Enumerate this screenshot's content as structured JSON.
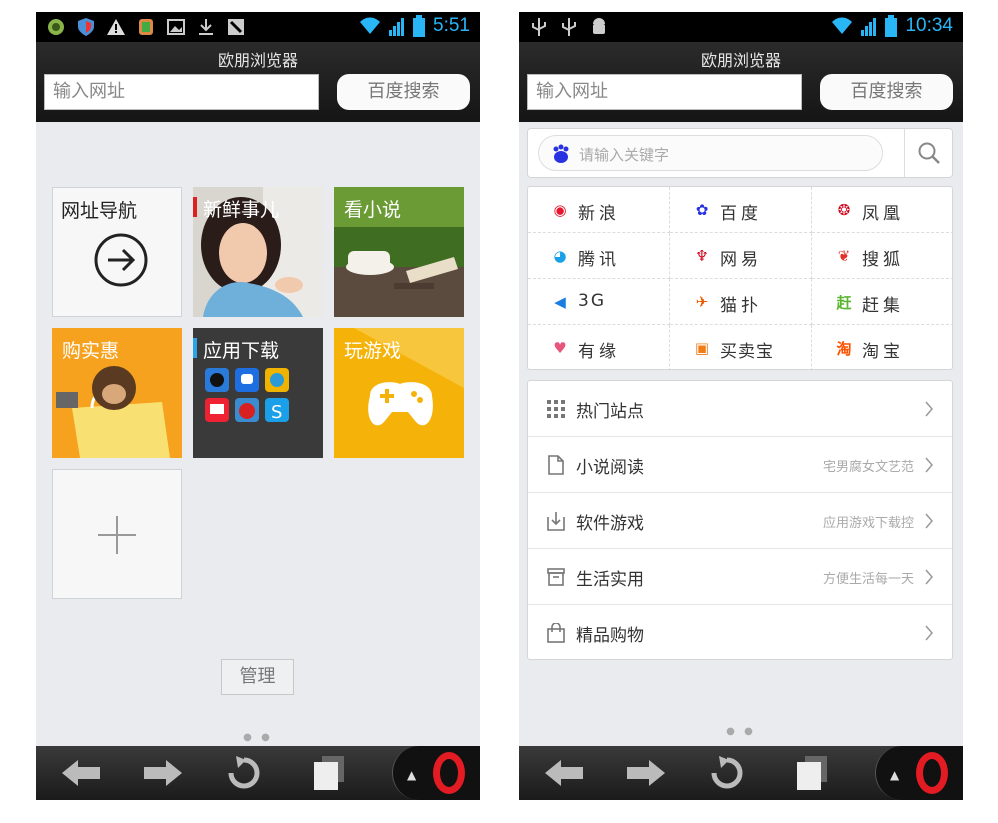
{
  "colors": {
    "status_time": "#29b6f6",
    "opera_red": "#e31b23",
    "tile_orange": "#f5a623",
    "tile_yellow": "#f6b600",
    "tile_dark": "#3a3a3a",
    "accent_red": "#e02020",
    "accent_blue": "#2aa3e8"
  },
  "left": {
    "status_time": "5:51",
    "app_title": "欧朋浏览器",
    "url_placeholder": "输入网址",
    "search_label": "百度搜索",
    "tiles": [
      {
        "label": "网址导航",
        "icon": "arrow-circle-icon"
      },
      {
        "label": "新鲜事儿",
        "icon": "woman-photo"
      },
      {
        "label": "看小说",
        "icon": "tea-book-photo"
      },
      {
        "label": "购实惠",
        "icon": "monkey-shopping-bag"
      },
      {
        "label": "应用下载",
        "icon": "app-icons-grid"
      },
      {
        "label": "玩游戏",
        "icon": "gamepad-icon"
      },
      {
        "label": "",
        "icon": "plus-icon"
      }
    ],
    "manage_label": "管理",
    "page_indicator": "● ●"
  },
  "right": {
    "status_time": "10:34",
    "app_title": "欧朋浏览器",
    "url_placeholder": "输入网址",
    "search_label": "百度搜索",
    "keyword_placeholder": "请输入关键字",
    "sites": [
      {
        "label": "新浪",
        "icon": "sina-weibo-icon",
        "color": "#e6162d"
      },
      {
        "label": "百度",
        "icon": "baidu-paw-icon",
        "color": "#2932e1"
      },
      {
        "label": "凤凰",
        "icon": "ifeng-icon",
        "color": "#d0021b"
      },
      {
        "label": "腾讯",
        "icon": "tencent-icon",
        "color": "#1aa0e8"
      },
      {
        "label": "网易",
        "icon": "netease-icon",
        "color": "#d0021b"
      },
      {
        "label": "搜狐",
        "icon": "sohu-fox-icon",
        "color": "#f3a31b"
      },
      {
        "label": "3G",
        "icon": "3g-icon",
        "color": "#1a7de0"
      },
      {
        "label": "猫扑",
        "icon": "mop-icon",
        "color": "#e65c00"
      },
      {
        "label": "赶集",
        "icon": "ganji-icon",
        "color": "#5cb531"
      },
      {
        "label": "有缘",
        "icon": "heart-icon",
        "color": "#e8557d"
      },
      {
        "label": "买卖宝",
        "icon": "maimaibao-icon",
        "color": "#f07d17"
      },
      {
        "label": "淘宝",
        "icon": "taobao-icon",
        "color": "#ff5000"
      }
    ],
    "categories": [
      {
        "label": "热门站点",
        "subtitle": "",
        "icon": "grid-dots-icon"
      },
      {
        "label": "小说阅读",
        "subtitle": "宅男腐女文艺范",
        "icon": "document-icon"
      },
      {
        "label": "软件游戏",
        "subtitle": "应用游戏下载控",
        "icon": "download-icon"
      },
      {
        "label": "生活实用",
        "subtitle": "方便生活每一天",
        "icon": "box-icon"
      },
      {
        "label": "精品购物",
        "subtitle": "",
        "icon": "shopping-bag-icon"
      }
    ],
    "page_indicator": "● ●"
  }
}
